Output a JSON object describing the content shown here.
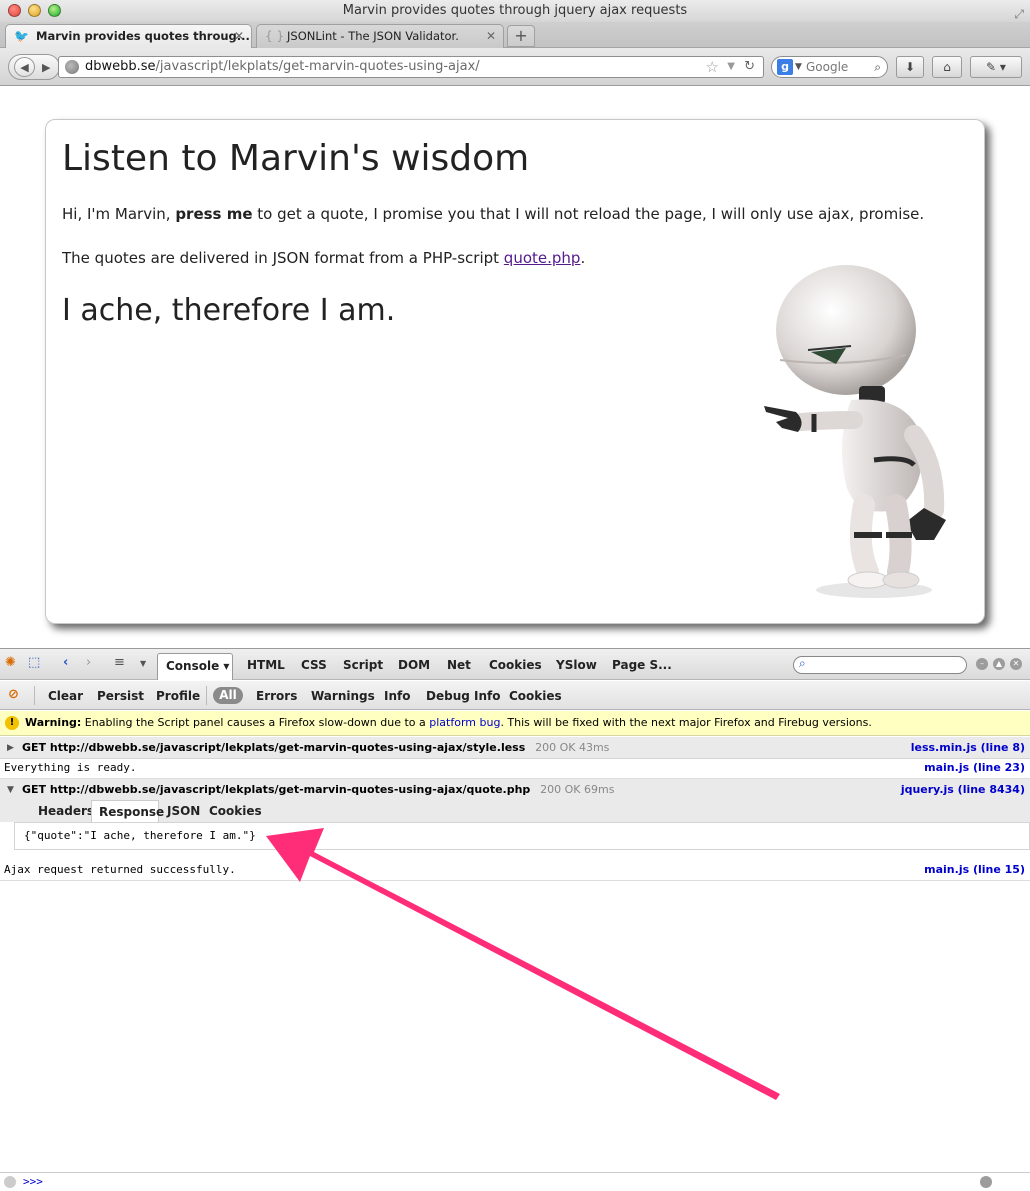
{
  "window": {
    "title": "Marvin provides quotes through jquery ajax requests"
  },
  "tabs": [
    {
      "label": "Marvin provides quotes throug...",
      "close": "✕",
      "active": true
    },
    {
      "label": "JSONLint - The JSON Validator.",
      "close": "✕",
      "active": false
    }
  ],
  "new_tab": "+",
  "url": {
    "host": "dbwebb.se",
    "path": "/javascript/lekplats/get-marvin-quotes-using-ajax/"
  },
  "search": {
    "engine_letter": "g",
    "placeholder": "Google"
  },
  "page": {
    "heading": "Listen to Marvin's wisdom",
    "intro_before": "Hi, I'm Marvin, ",
    "intro_bold": "press me",
    "intro_after": " to get a quote, I promise you that I will not reload the page, I will only use ajax, promise.",
    "format_before": "The quotes are delivered in JSON format from a PHP-script ",
    "format_link": "quote.php",
    "format_after": ".",
    "quote": "I ache, therefore I am."
  },
  "firebug": {
    "tabs": [
      "Console",
      "HTML",
      "CSS",
      "Script",
      "DOM",
      "Net",
      "Cookies",
      "YSlow",
      "Page S..."
    ],
    "filters": [
      "Clear",
      "Persist",
      "Profile",
      "All",
      "Errors",
      "Warnings",
      "Info",
      "Debug Info",
      "Cookies"
    ],
    "warning": {
      "label": "Warning:",
      "before": " Enabling the Script panel causes a Firefox slow-down due to a ",
      "link": "platform bug",
      "after": ". This will be fixed with the next major Firefox and Firebug versions."
    },
    "rows": [
      {
        "method": "GET",
        "url": "http://dbwebb.se/javascript/lekplats/get-marvin-quotes-using-ajax/style.less",
        "status": "200 OK 43ms",
        "source": "less.min.js (line 8)"
      },
      {
        "text": "Everything is ready.",
        "source": "main.js (line 23)"
      },
      {
        "method": "GET",
        "url": "http://dbwebb.se/javascript/lekplats/get-marvin-quotes-using-ajax/quote.php",
        "status": "200 OK 69ms",
        "source": "jquery.js (line 8434)"
      },
      {
        "text": "Ajax request returned successfully.",
        "source": "main.js (line 15)"
      }
    ],
    "response_tabs": [
      "Headers",
      "Response",
      "JSON",
      "Cookies"
    ],
    "response_body": "{\"quote\":\"I ache, therefore I am.\"}",
    "cmd_prompt": ">>>"
  },
  "colors": {
    "link": "#551a8b",
    "source_link": "#0000cc",
    "warning_bg": "#ffffc2",
    "annotation_arrow": "#ff2d78"
  }
}
